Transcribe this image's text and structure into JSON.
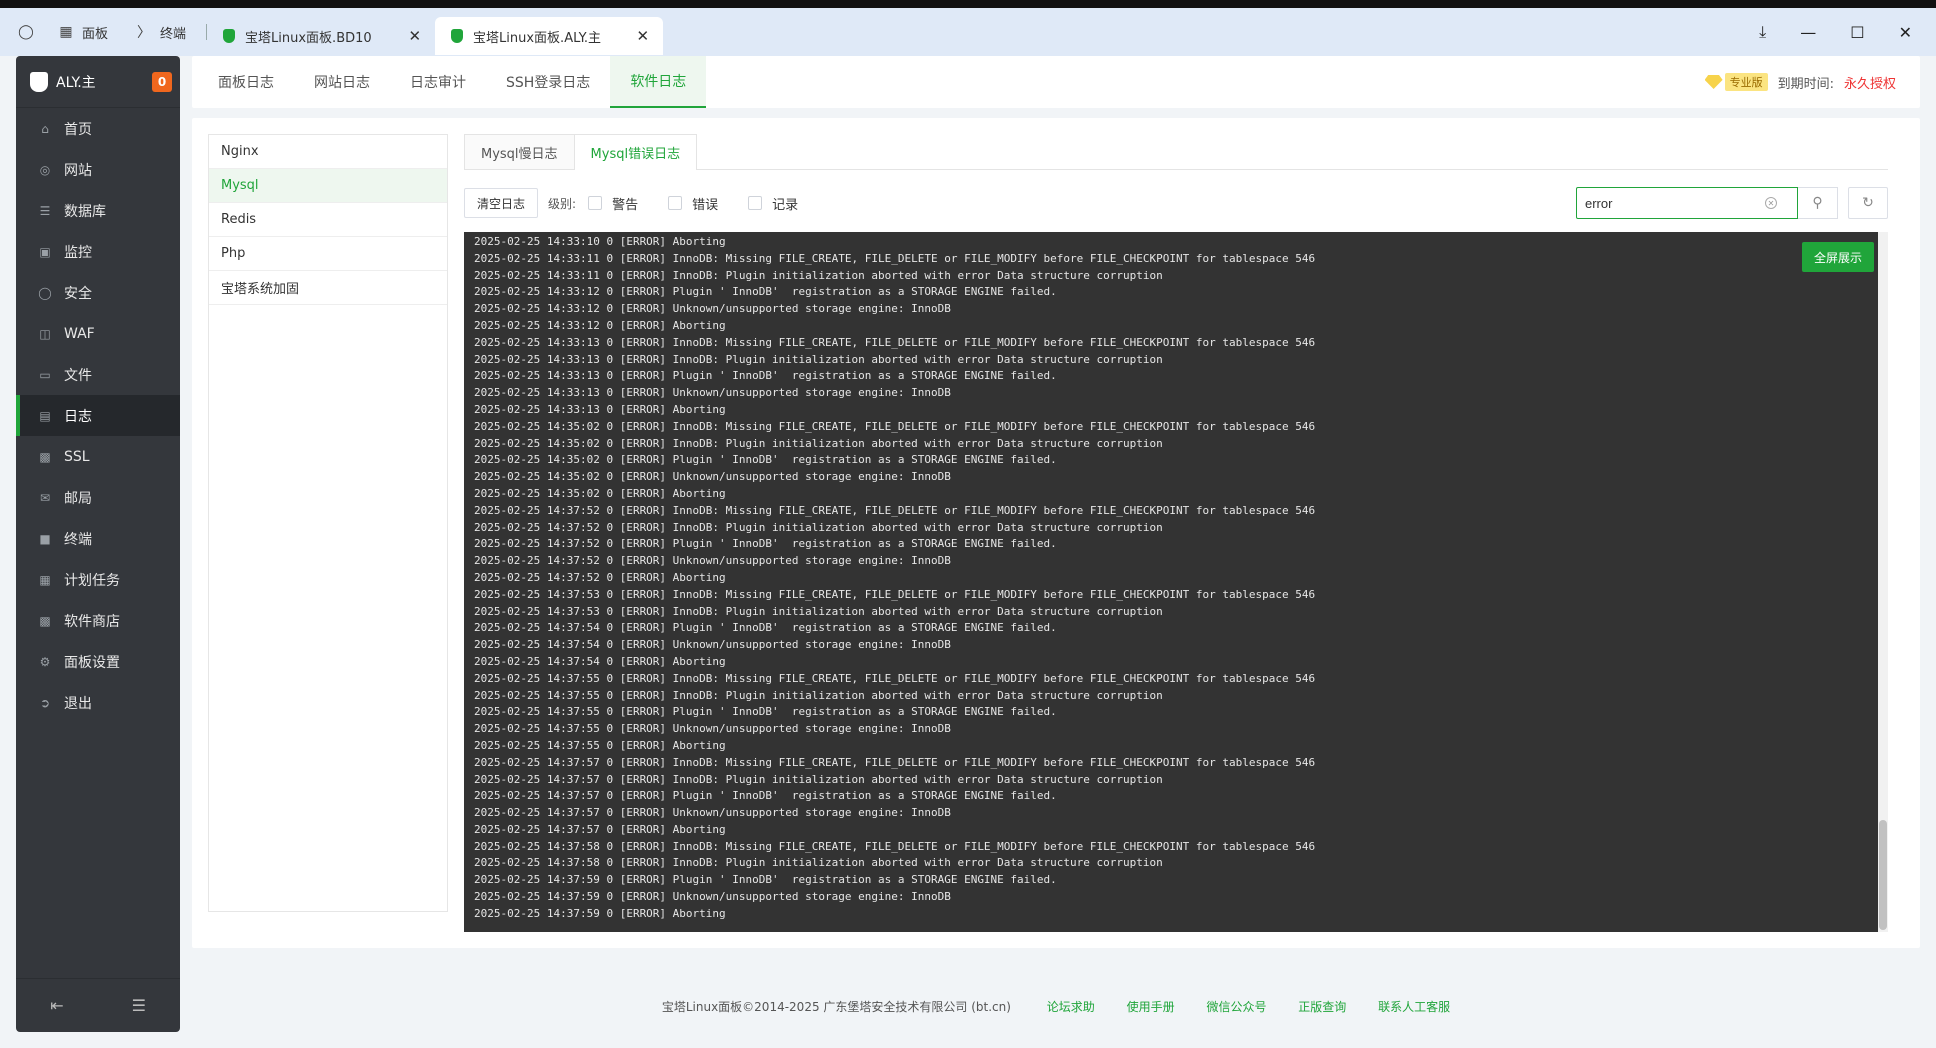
{
  "browser": {
    "left_buttons": [
      {
        "label": "面板"
      },
      {
        "label": "终端"
      }
    ],
    "tabs": [
      {
        "title": "宝塔Linux面板.BD10",
        "active": false
      },
      {
        "title": "宝塔Linux面板.ALY.主",
        "active": true
      }
    ]
  },
  "sidebar": {
    "title": "ALY.主",
    "badge": "0",
    "items": [
      {
        "label": "首页",
        "icon": "home-icon"
      },
      {
        "label": "网站",
        "icon": "globe-icon"
      },
      {
        "label": "数据库",
        "icon": "database-icon"
      },
      {
        "label": "监控",
        "icon": "monitor-icon"
      },
      {
        "label": "安全",
        "icon": "shield-icon"
      },
      {
        "label": "WAF",
        "icon": "waf-shield-icon"
      },
      {
        "label": "文件",
        "icon": "folder-icon"
      },
      {
        "label": "日志",
        "icon": "log-icon",
        "active": true
      },
      {
        "label": "SSL",
        "icon": "ssl-icon"
      },
      {
        "label": "邮局",
        "icon": "mail-icon"
      },
      {
        "label": "终端",
        "icon": "terminal-icon"
      },
      {
        "label": "计划任务",
        "icon": "schedule-icon"
      },
      {
        "label": "软件商店",
        "icon": "store-icon"
      },
      {
        "label": "面板设置",
        "icon": "settings-icon"
      },
      {
        "label": "退出",
        "icon": "logout-icon"
      }
    ]
  },
  "topnav": {
    "tabs": [
      {
        "label": "面板日志"
      },
      {
        "label": "网站日志"
      },
      {
        "label": "日志审计"
      },
      {
        "label": "SSH登录日志"
      },
      {
        "label": "软件日志",
        "active": true
      }
    ],
    "pro_tag": "专业版",
    "expire_label": "到期时间:",
    "expire_value": "永久授权"
  },
  "softlist": [
    "Nginx",
    "Mysql",
    "Redis",
    "Php",
    "宝塔系统加固"
  ],
  "subtabs": [
    {
      "label": "Mysql慢日志"
    },
    {
      "label": "Mysql错误日志",
      "active": true
    }
  ],
  "toolbar": {
    "clear_label": "清空日志",
    "level_label": "级别:",
    "levels": [
      "警告",
      "错误",
      "记录"
    ],
    "search_value": "error"
  },
  "console": {
    "fullscreen_label": "全屏展示",
    "lines": [
      "2025-02-25 14:33:10 0 [ERROR] Aborting",
      "2025-02-25 14:33:11 0 [ERROR] InnoDB: Missing FILE_CREATE, FILE_DELETE or FILE_MODIFY before FILE_CHECKPOINT for tablespace 546",
      "2025-02-25 14:33:11 0 [ERROR] InnoDB: Plugin initialization aborted with error Data structure corruption",
      "2025-02-25 14:33:12 0 [ERROR] Plugin ' InnoDB'  registration as a STORAGE ENGINE failed.",
      "2025-02-25 14:33:12 0 [ERROR] Unknown/unsupported storage engine: InnoDB",
      "2025-02-25 14:33:12 0 [ERROR] Aborting",
      "2025-02-25 14:33:13 0 [ERROR] InnoDB: Missing FILE_CREATE, FILE_DELETE or FILE_MODIFY before FILE_CHECKPOINT for tablespace 546",
      "2025-02-25 14:33:13 0 [ERROR] InnoDB: Plugin initialization aborted with error Data structure corruption",
      "2025-02-25 14:33:13 0 [ERROR] Plugin ' InnoDB'  registration as a STORAGE ENGINE failed.",
      "2025-02-25 14:33:13 0 [ERROR] Unknown/unsupported storage engine: InnoDB",
      "2025-02-25 14:33:13 0 [ERROR] Aborting",
      "2025-02-25 14:35:02 0 [ERROR] InnoDB: Missing FILE_CREATE, FILE_DELETE or FILE_MODIFY before FILE_CHECKPOINT for tablespace 546",
      "2025-02-25 14:35:02 0 [ERROR] InnoDB: Plugin initialization aborted with error Data structure corruption",
      "2025-02-25 14:35:02 0 [ERROR] Plugin ' InnoDB'  registration as a STORAGE ENGINE failed.",
      "2025-02-25 14:35:02 0 [ERROR] Unknown/unsupported storage engine: InnoDB",
      "2025-02-25 14:35:02 0 [ERROR] Aborting",
      "2025-02-25 14:37:52 0 [ERROR] InnoDB: Missing FILE_CREATE, FILE_DELETE or FILE_MODIFY before FILE_CHECKPOINT for tablespace 546",
      "2025-02-25 14:37:52 0 [ERROR] InnoDB: Plugin initialization aborted with error Data structure corruption",
      "2025-02-25 14:37:52 0 [ERROR] Plugin ' InnoDB'  registration as a STORAGE ENGINE failed.",
      "2025-02-25 14:37:52 0 [ERROR] Unknown/unsupported storage engine: InnoDB",
      "2025-02-25 14:37:52 0 [ERROR] Aborting",
      "2025-02-25 14:37:53 0 [ERROR] InnoDB: Missing FILE_CREATE, FILE_DELETE or FILE_MODIFY before FILE_CHECKPOINT for tablespace 546",
      "2025-02-25 14:37:53 0 [ERROR] InnoDB: Plugin initialization aborted with error Data structure corruption",
      "2025-02-25 14:37:54 0 [ERROR] Plugin ' InnoDB'  registration as a STORAGE ENGINE failed.",
      "2025-02-25 14:37:54 0 [ERROR] Unknown/unsupported storage engine: InnoDB",
      "2025-02-25 14:37:54 0 [ERROR] Aborting",
      "2025-02-25 14:37:55 0 [ERROR] InnoDB: Missing FILE_CREATE, FILE_DELETE or FILE_MODIFY before FILE_CHECKPOINT for tablespace 546",
      "2025-02-25 14:37:55 0 [ERROR] InnoDB: Plugin initialization aborted with error Data structure corruption",
      "2025-02-25 14:37:55 0 [ERROR] Plugin ' InnoDB'  registration as a STORAGE ENGINE failed.",
      "2025-02-25 14:37:55 0 [ERROR] Unknown/unsupported storage engine: InnoDB",
      "2025-02-25 14:37:55 0 [ERROR] Aborting",
      "2025-02-25 14:37:57 0 [ERROR] InnoDB: Missing FILE_CREATE, FILE_DELETE or FILE_MODIFY before FILE_CHECKPOINT for tablespace 546",
      "2025-02-25 14:37:57 0 [ERROR] InnoDB: Plugin initialization aborted with error Data structure corruption",
      "2025-02-25 14:37:57 0 [ERROR] Plugin ' InnoDB'  registration as a STORAGE ENGINE failed.",
      "2025-02-25 14:37:57 0 [ERROR] Unknown/unsupported storage engine: InnoDB",
      "2025-02-25 14:37:57 0 [ERROR] Aborting",
      "2025-02-25 14:37:58 0 [ERROR] InnoDB: Missing FILE_CREATE, FILE_DELETE or FILE_MODIFY before FILE_CHECKPOINT for tablespace 546",
      "2025-02-25 14:37:58 0 [ERROR] InnoDB: Plugin initialization aborted with error Data structure corruption",
      "2025-02-25 14:37:59 0 [ERROR] Plugin ' InnoDB'  registration as a STORAGE ENGINE failed.",
      "2025-02-25 14:37:59 0 [ERROR] Unknown/unsupported storage engine: InnoDB",
      "2025-02-25 14:37:59 0 [ERROR] Aborting"
    ]
  },
  "footer": {
    "copyright": "宝塔Linux面板©2014-2025 广东堡塔安全技术有限公司 (bt.cn)",
    "links": [
      "论坛求助",
      "使用手册",
      "微信公众号",
      "正版查询",
      "联系人工客服"
    ]
  },
  "colors": {
    "accent": "#20a53a",
    "sidebar_bg": "#34373c",
    "console_bg": "#333333",
    "expire": "#ee3333"
  }
}
